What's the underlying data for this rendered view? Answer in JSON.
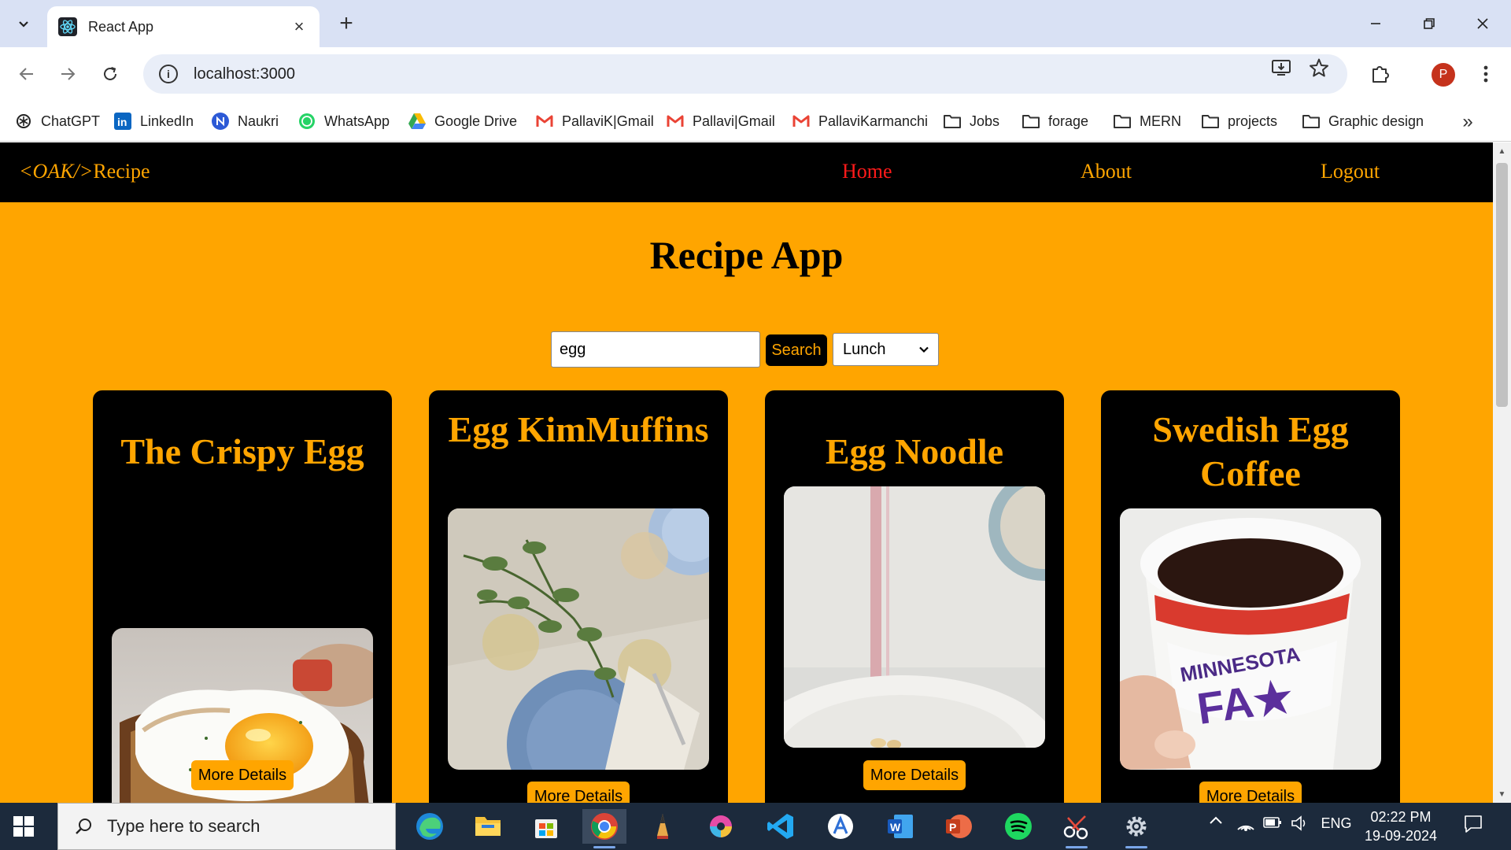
{
  "browser": {
    "tab_title": "React App",
    "url": "localhost:3000",
    "profile_initial": "P",
    "bookmarks": [
      {
        "label": "ChatGPT",
        "icon": "chatgpt-icon"
      },
      {
        "label": "LinkedIn",
        "icon": "linkedin-icon"
      },
      {
        "label": "Naukri",
        "icon": "naukri-icon"
      },
      {
        "label": "WhatsApp",
        "icon": "whatsapp-icon"
      },
      {
        "label": "Google Drive",
        "icon": "google-drive-icon"
      },
      {
        "label": "PallaviK|Gmail",
        "icon": "gmail-icon"
      },
      {
        "label": "Pallavi|Gmail",
        "icon": "gmail-icon"
      },
      {
        "label": "PallaviKarmanchi",
        "icon": "gmail-icon"
      },
      {
        "label": "Jobs",
        "icon": "folder-icon"
      },
      {
        "label": "forage",
        "icon": "folder-icon"
      },
      {
        "label": "MERN",
        "icon": "folder-icon"
      },
      {
        "label": "projects",
        "icon": "folder-icon"
      },
      {
        "label": "Graphic design",
        "icon": "folder-icon"
      }
    ]
  },
  "app": {
    "brand_prefix": "<OAK/>",
    "brand_suffix": "Recipe",
    "nav": {
      "home": "Home",
      "about": "About",
      "logout": "Logout"
    },
    "title": "Recipe App",
    "search": {
      "value": "egg",
      "button": "Search",
      "meal_type": "Lunch"
    },
    "recipes": [
      {
        "title": "The Crispy Egg",
        "button": "More Details"
      },
      {
        "title": "Egg KimMuffins",
        "button": "More Details"
      },
      {
        "title": "Egg Noodle",
        "button": "More Details"
      },
      {
        "title": "Swedish Egg Coffee",
        "button": "More Details"
      }
    ],
    "colors": {
      "accent": "#ffa500",
      "background": "#ffa500",
      "card": "#000000",
      "active_link": "#ff1a1a"
    }
  },
  "taskbar": {
    "search_placeholder": "Type here to search",
    "language": "ENG",
    "time": "02:22 PM",
    "date": "19-09-2024"
  }
}
